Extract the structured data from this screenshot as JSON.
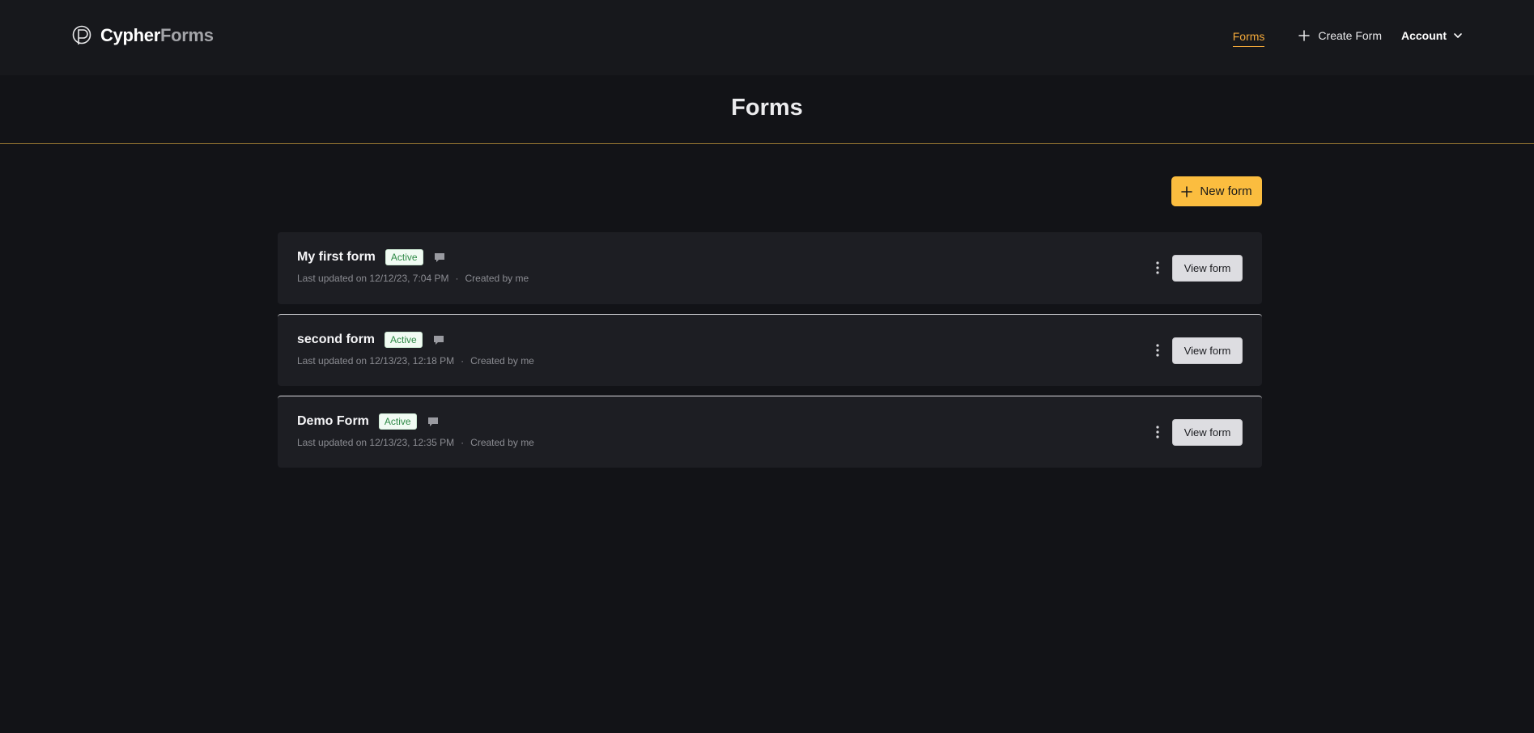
{
  "brand": {
    "name_part1": "Cypher",
    "name_part2": "Forms",
    "logo_icon": "cypherforms-logo-icon"
  },
  "nav": {
    "forms_label": "Forms",
    "create_label": "Create Form",
    "account_label": "Account",
    "active_color": "#f4a93a"
  },
  "page": {
    "title": "Forms"
  },
  "actions": {
    "new_form_label": "New form",
    "accent_color": "#fbbd3f"
  },
  "forms": [
    {
      "name": "My first form",
      "status": "Active",
      "updated": "Last updated on 12/12/23, 7:04 PM",
      "separator": "·",
      "created_by": "Created by me",
      "view_label": "View form"
    },
    {
      "name": "second form",
      "status": "Active",
      "updated": "Last updated on 12/13/23, 12:18 PM",
      "separator": "·",
      "created_by": "Created by me",
      "view_label": "View form"
    },
    {
      "name": "Demo Form",
      "status": "Active",
      "updated": "Last updated on 12/13/23, 12:35 PM",
      "separator": "·",
      "created_by": "Created by me",
      "view_label": "View form"
    }
  ]
}
